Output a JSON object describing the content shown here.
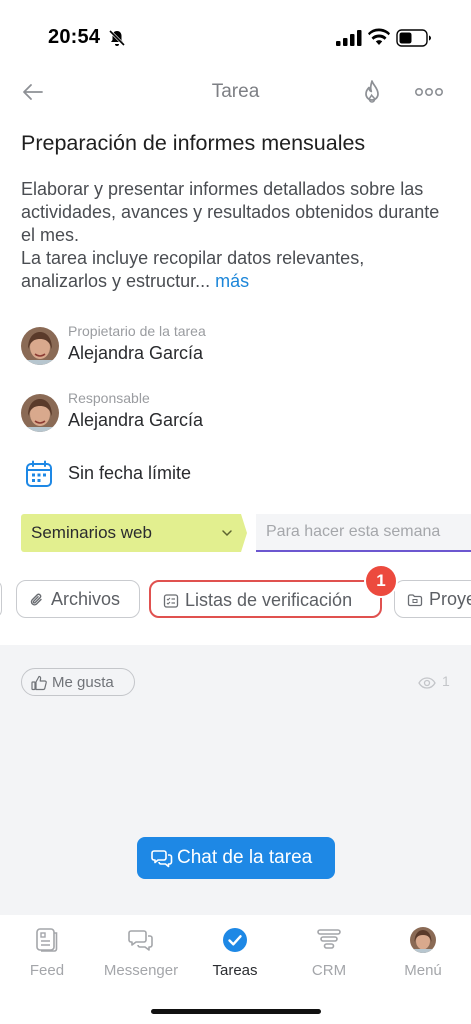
{
  "status_bar": {
    "time": "20:54"
  },
  "header": {
    "title": "Tarea"
  },
  "task": {
    "title": "Preparación de informes mensuales",
    "description": "Elaborar y presentar informes detallados sobre las actividades, avances y resultados obtenidos durante el mes.\nLa tarea incluye recopilar datos relevantes, analizarlos y estructur...",
    "more_link": "más"
  },
  "owner": {
    "role": "Propietario de la tarea",
    "name": "Alejandra García"
  },
  "responsible": {
    "role": "Responsable",
    "name": "Alejandra García"
  },
  "deadline": {
    "label": "Sin fecha límite"
  },
  "stage": {
    "value": "Seminarios web",
    "color": "#e2ef8f"
  },
  "kanban": {
    "placeholder": "Para hacer esta semana"
  },
  "tabs": [
    {
      "label": "Archivos",
      "icon": "paperclip-icon"
    },
    {
      "label": "Listas de verificación",
      "icon": "checklist-icon"
    },
    {
      "label": "Proye",
      "icon": "folder-icon"
    }
  ],
  "notification_badge": "1",
  "like": {
    "label": "Me gusta"
  },
  "views": {
    "count": "1"
  },
  "chat_button": {
    "label": "Chat de la tarea"
  },
  "bottom_nav": [
    {
      "label": "Feed",
      "icon": "feed-icon"
    },
    {
      "label": "Messenger",
      "icon": "messenger-icon"
    },
    {
      "label": "Tareas",
      "icon": "tasks-check-icon"
    },
    {
      "label": "CRM",
      "icon": "crm-funnel-icon"
    },
    {
      "label": "Menú",
      "icon": "avatar-menu-icon"
    }
  ],
  "colors": {
    "accent": "#1e88e5",
    "highlight_border": "#e0514f",
    "badge": "#ec4a3e",
    "link": "#1c86d9"
  }
}
